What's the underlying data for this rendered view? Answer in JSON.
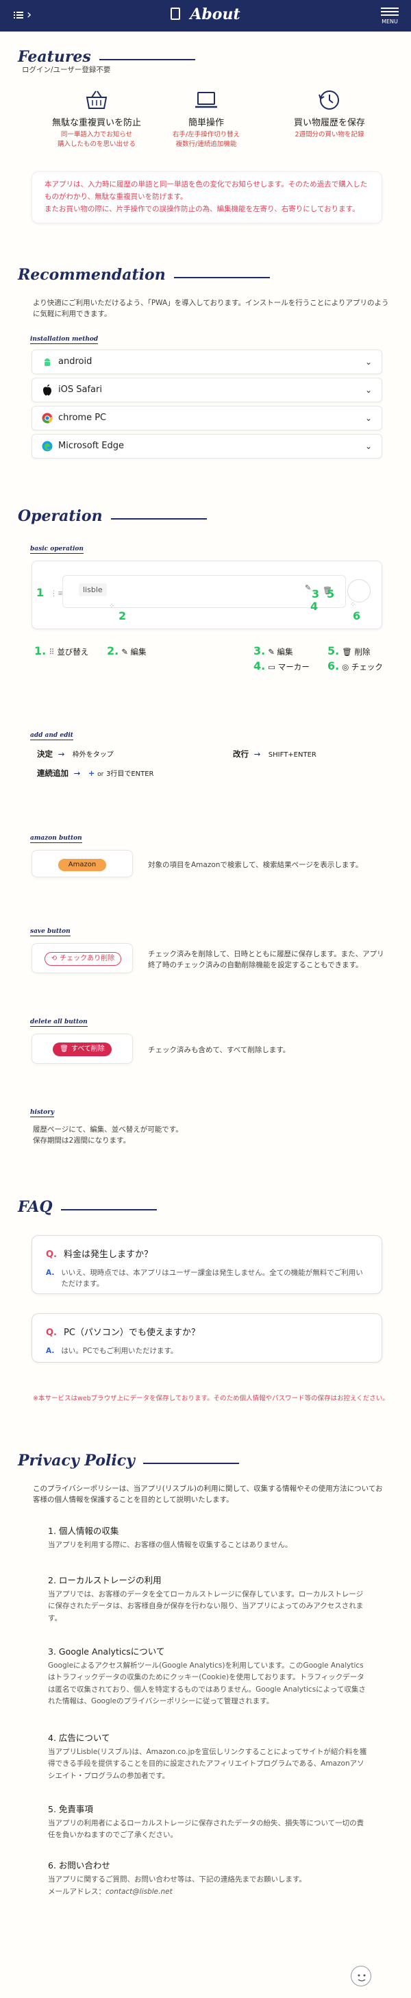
{
  "header": {
    "title": "About",
    "menu_label": "MENU",
    "back_icon": "back-list-icon",
    "doc_icon": "document-icon"
  },
  "features": {
    "title": "Features",
    "subtitle": "ログイン/ユーザー登録不要",
    "items": [
      {
        "icon": "basket-icon",
        "title": "無駄な重複買いを防止",
        "desc1": "同一単語入力でお知らせ",
        "desc2": "購入したものを思い出せる"
      },
      {
        "icon": "laptop-icon",
        "title": "簡単操作",
        "desc1": "右手/左手操作切り替え",
        "desc2": "複数行/連続追加機能"
      },
      {
        "icon": "history-icon",
        "title": "買い物履歴を保存",
        "desc1": "2週間分の買い物を記録",
        "desc2": ""
      }
    ],
    "notice": [
      "本アプリは、入力時に履歴の単語と同一単語を色の変化でお知らせします。そのため過去で購入したものがわかり、無駄な重複買いを防げます。",
      "またお買い物の際に、片手操作での誤操作防止の為、編集機能を左寄り、右寄りにしております。"
    ]
  },
  "recommendation": {
    "title": "Recommendation",
    "text": [
      "より快適にご利用いただけるよう、「PWA」を導入しております。インストールを行うことによりアプリのように気軽に利用できます。"
    ],
    "install_label": "installation method",
    "methods": [
      {
        "label": "android",
        "icon": "android-icon"
      },
      {
        "label": "iOS Safari",
        "icon": "apple-icon"
      },
      {
        "label": "chrome PC",
        "icon": "chrome-icon"
      },
      {
        "label": "Microsoft Edge",
        "icon": "edge-icon"
      }
    ]
  },
  "operation": {
    "title": "Operation",
    "basic_label": "basic operation",
    "demo_text": "lisble",
    "markers": [
      "1",
      "2",
      "3",
      "4",
      "5",
      "6"
    ],
    "legend": [
      {
        "num": "1.",
        "icon": "drag-icon",
        "label": "並び替え"
      },
      {
        "num": "2.",
        "icon": "pencil-icon",
        "label": "編集"
      },
      {
        "num": "3.",
        "icon": "pencil-icon",
        "label": "編集"
      },
      {
        "num": "4.",
        "icon": "marker-icon",
        "label": "マーカー"
      },
      {
        "num": "5.",
        "icon": "trash-icon",
        "label": "削除"
      },
      {
        "num": "6.",
        "icon": "check-circle-icon",
        "label": "チェック"
      }
    ],
    "add_label": "add and edit",
    "decide": {
      "label": "決定",
      "arrow": "→",
      "value": "枠外をタップ"
    },
    "newline": {
      "label": "改行",
      "arrow": "→",
      "value": "SHIFT+ENTER"
    },
    "continuous": {
      "label": "連続追加",
      "arrow": "→",
      "plus": "+",
      "or": "or",
      "value": "3行目でENTER"
    },
    "amazon_label": "amazon button",
    "amazon_button": "Amazon",
    "amazon_desc": "対象の項目をAmazonで検索して、検索結果ページを表示します。",
    "save_label": "save button",
    "save_button": "チェックあり削除",
    "save_desc": "チェック済みを削除して、日時とともに履歴に保存します。また、アプリ終了時のチェック済みの自動削除機能を設定することもできます。",
    "deleteall_label": "delete all button",
    "deleteall_button": "すべて削除",
    "deleteall_desc": "チェック済みも含めて、すべて削除します。",
    "history_label": "history",
    "history_text": [
      "履歴ページにて、編集、並べ替えが可能です。",
      "保存期間は2週間になります。"
    ]
  },
  "faq": {
    "title": "FAQ",
    "items": [
      {
        "q": "料金は発生しますか？",
        "a": "いいえ、現時点では、本アプリはユーザー課金は発生しません。全ての機能が無料でご利用いただけます。"
      },
      {
        "q": "PC（パソコン）でも使えますか？",
        "a": "はい。PCでもご利用いただけます。"
      }
    ],
    "q_mark": "Q.",
    "a_mark": "A.",
    "note": "※本サービスはwebブラウザ上にデータを保存しております。そのため個人情報やパスワード等の保存はお控えください。"
  },
  "privacy": {
    "title": "Privacy Policy",
    "intro": "このプライバシーポリシーは、当アプリ(リスブル)の利用に関して、収集する情報やその使用方法についてお客様の個人情報を保護することを目的として説明いたします。",
    "sections": [
      {
        "h": "1. 個人情報の収集",
        "p": "当アプリを利用する際に、お客様の個人情報を収集することはありません。"
      },
      {
        "h": "2. ローカルストレージの利用",
        "p": "当アプリでは、お客様のデータを全てローカルストレージに保存しています。ローカルストレージに保存されたデータは、お客様自身が保存を行わない限り、当アプリによってのみアクセスされます。"
      },
      {
        "h": "3. Google Analyticsについて",
        "p": "Googleによるアクセス解析ツール(Google Analytics)を利用しています。このGoogle Analyticsはトラフィックデータの収集のためにクッキー(Cookie)を使用しております。トラフィックデータは匿名で収集されており、個人を特定するものではありません。Google Analyticsによって収集された情報は、Googleのプライバシーポリシーに従って管理されます。"
      },
      {
        "h": "4. 広告について",
        "p": "当アプリLisble(リスブル)は、Amazon.co.jpを宣伝しリンクすることによってサイトが紹介料を獲得できる手段を提供することを目的に設定されたアフィリエイトプログラムである、Amazonアソシエイト・プログラムの参加者です。"
      },
      {
        "h": "5. 免責事項",
        "p": "当アプリの利用者によるローカルストレージに保存されたデータの紛失、損失等について一切の責任を負いかねますのでご了承ください。"
      },
      {
        "h": "6. お問い合わせ",
        "p": "当アプリに関するご質問、お問い合わせ等は、下記の連絡先までお願いします。"
      }
    ],
    "email_label": "メールアドレス：",
    "email": "contact@lisble.net"
  },
  "colors": {
    "navy": "#1f2c61",
    "green": "#22c55e",
    "pink": "#e0435b",
    "amazon": "#f5a24a",
    "delete": "#d6284f"
  }
}
